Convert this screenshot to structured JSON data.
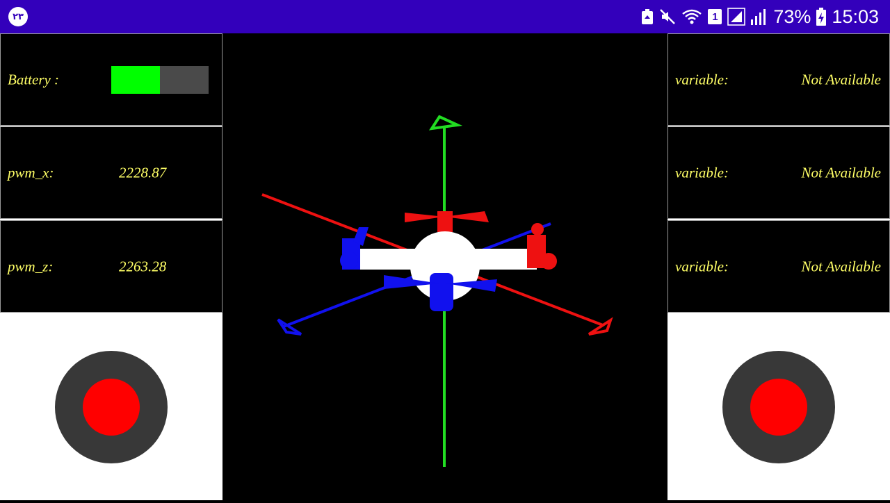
{
  "status_bar": {
    "app_badge": "۲۳",
    "battery_percent": "73%",
    "time": "15:03",
    "sim_slot": "1",
    "icons": [
      "recycle-notification-icon",
      "mute-icon",
      "wifi-icon",
      "sim-icon",
      "signal-icon",
      "battery-charging-icon"
    ]
  },
  "left_panel": {
    "battery": {
      "label": "Battery :",
      "level": 0.5,
      "fill_color": "#00ff00"
    },
    "pwm_x": {
      "label": "pwm_x:",
      "value": "2228.87"
    },
    "pwm_z": {
      "label": "pwm_z:",
      "value": "2263.28"
    }
  },
  "right_panel": {
    "variables": [
      {
        "label": "variable:",
        "value": "Not Available"
      },
      {
        "label": "variable:",
        "value": "Not Available"
      },
      {
        "label": "variable:",
        "value": "Not Available"
      }
    ]
  },
  "colors": {
    "status_bar": "#3300bb",
    "cell_text": "#ffff66",
    "x_axis": "#ff2020",
    "y_axis": "#22dd22",
    "z_axis": "#1111ee",
    "joystick_ring": "#383838",
    "joystick_knob": "#ff0000"
  },
  "joysticks": [
    "left",
    "right"
  ]
}
